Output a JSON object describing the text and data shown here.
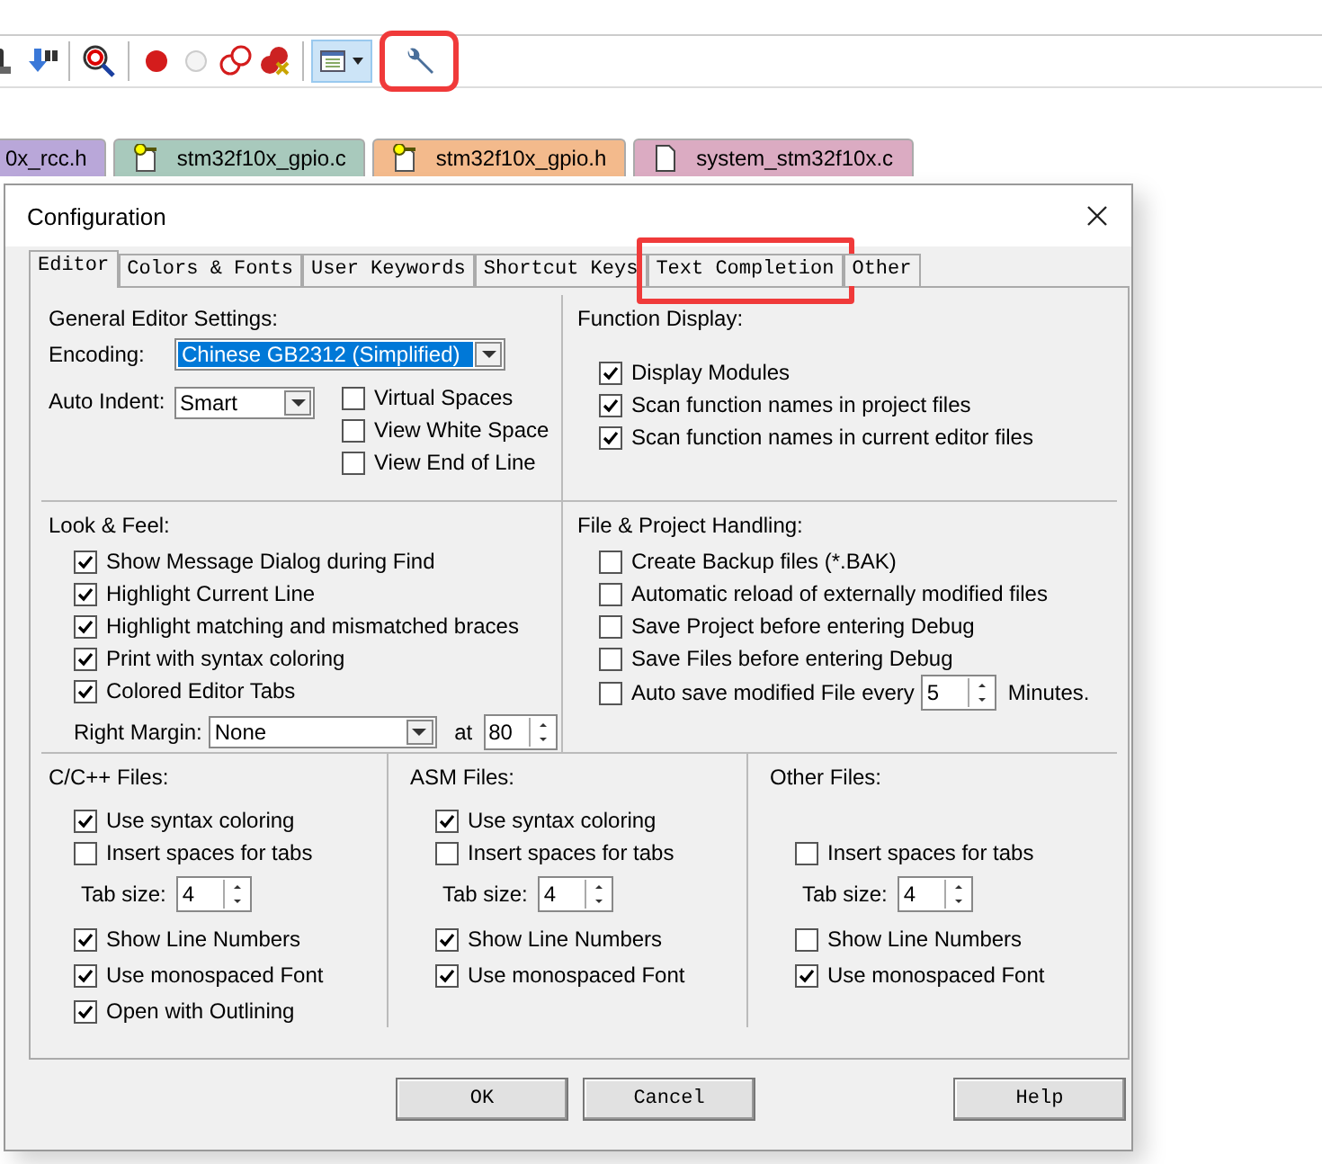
{
  "toolbar": [
    {
      "kind": "find",
      "pressed": false,
      "highlighted": false
    },
    {
      "kind": "debug",
      "pressed": false,
      "highlighted": false
    },
    {
      "kind": "breakpoint",
      "pressed": false,
      "highlighted": false
    },
    {
      "kind": "breakpoint-off",
      "pressed": false,
      "highlighted": false
    },
    {
      "kind": "breakpoints-disable",
      "pressed": false,
      "highlighted": false
    },
    {
      "kind": "breakpoints-kill",
      "pressed": false,
      "highlighted": false
    },
    {
      "kind": "window",
      "pressed": true,
      "highlighted": false
    },
    {
      "kind": "configure",
      "pressed": false,
      "highlighted": true
    }
  ],
  "file_tabs": [
    {
      "label": "0x_rcc.h",
      "color": "#b9a7d9",
      "kind": "plain"
    },
    {
      "label": "stm32f10x_gpio.c",
      "color": "#a8c9bc",
      "kind": "key"
    },
    {
      "label": "stm32f10x_gpio.h",
      "color": "#f3ba8c",
      "kind": "key"
    },
    {
      "label": "system_stm32f10x.c",
      "color": "#dbabc2",
      "kind": "file"
    }
  ],
  "dialog": {
    "title": "Configuration",
    "tabs": [
      {
        "label": "Editor",
        "selected": true,
        "highlighted": false
      },
      {
        "label": "Colors & Fonts",
        "selected": false,
        "highlighted": false
      },
      {
        "label": "User Keywords",
        "selected": false,
        "highlighted": false
      },
      {
        "label": "Shortcut Keys",
        "selected": false,
        "highlighted": false
      },
      {
        "label": "Text Completion",
        "selected": false,
        "highlighted": true
      },
      {
        "label": "Other",
        "selected": false,
        "highlighted": false
      }
    ],
    "general": {
      "title": "General Editor Settings:",
      "encoding_label": "Encoding:",
      "encoding_value": "Chinese GB2312 (Simplified)",
      "auto_indent_label": "Auto Indent:",
      "auto_indent_value": "Smart",
      "options": [
        {
          "label": "Virtual Spaces",
          "checked": false
        },
        {
          "label": "View White Space",
          "checked": false
        },
        {
          "label": "View End of Line",
          "checked": false
        }
      ]
    },
    "function_display": {
      "title": "Function Display:",
      "options": [
        {
          "label": "Display Modules",
          "checked": true
        },
        {
          "label": "Scan function names in project files",
          "checked": true
        },
        {
          "label": "Scan function names in current editor files",
          "checked": true
        }
      ]
    },
    "look_feel": {
      "title": "Look & Feel:",
      "options": [
        {
          "label": "Show Message Dialog during Find",
          "checked": true
        },
        {
          "label": "Highlight Current Line",
          "checked": true
        },
        {
          "label": "Highlight matching and mismatched braces",
          "checked": true
        },
        {
          "label": "Print with syntax coloring",
          "checked": true
        },
        {
          "label": "Colored Editor Tabs",
          "checked": true
        }
      ],
      "right_margin_label": "Right Margin:",
      "right_margin_value": "None",
      "at_label": "at",
      "at_value": "80"
    },
    "file_handling": {
      "title": "File & Project Handling:",
      "options": [
        {
          "label": "Create Backup files (*.BAK)",
          "checked": false
        },
        {
          "label": "Automatic reload of externally modified files",
          "checked": false
        },
        {
          "label": "Save Project before entering Debug",
          "checked": false
        },
        {
          "label": "Save Files before entering Debug",
          "checked": false
        }
      ],
      "auto_save": {
        "label": "Auto save modified File every",
        "checked": false,
        "value": "5",
        "suffix": "Minutes."
      }
    },
    "file_types": [
      {
        "title": "C/C++ Files:",
        "items": [
          {
            "kind": "checkbox",
            "label": "Use syntax coloring",
            "checked": true
          },
          {
            "kind": "checkbox",
            "label": "Insert spaces for tabs",
            "checked": false
          },
          {
            "kind": "spin",
            "label": "Tab size:",
            "value": "4"
          },
          {
            "kind": "checkbox",
            "label": "Show Line Numbers",
            "checked": true
          },
          {
            "kind": "checkbox",
            "label": "Use monospaced Font",
            "checked": true
          },
          {
            "kind": "checkbox",
            "label": "Open with Outlining",
            "checked": true
          }
        ]
      },
      {
        "title": "ASM Files:",
        "items": [
          {
            "kind": "checkbox",
            "label": "Use syntax coloring",
            "checked": true
          },
          {
            "kind": "checkbox",
            "label": "Insert spaces for tabs",
            "checked": false
          },
          {
            "kind": "spin",
            "label": "Tab size:",
            "value": "4"
          },
          {
            "kind": "checkbox",
            "label": "Show Line Numbers",
            "checked": true
          },
          {
            "kind": "checkbox",
            "label": "Use monospaced Font",
            "checked": true
          }
        ]
      },
      {
        "title": "Other Files:",
        "items": [
          {
            "kind": "blank"
          },
          {
            "kind": "checkbox",
            "label": "Insert spaces for tabs",
            "checked": false
          },
          {
            "kind": "spin",
            "label": "Tab size:",
            "value": "4"
          },
          {
            "kind": "checkbox",
            "label": "Show Line Numbers",
            "checked": false
          },
          {
            "kind": "checkbox",
            "label": "Use monospaced Font",
            "checked": true
          }
        ]
      }
    ],
    "buttons": [
      "OK",
      "Cancel",
      "Help"
    ]
  }
}
